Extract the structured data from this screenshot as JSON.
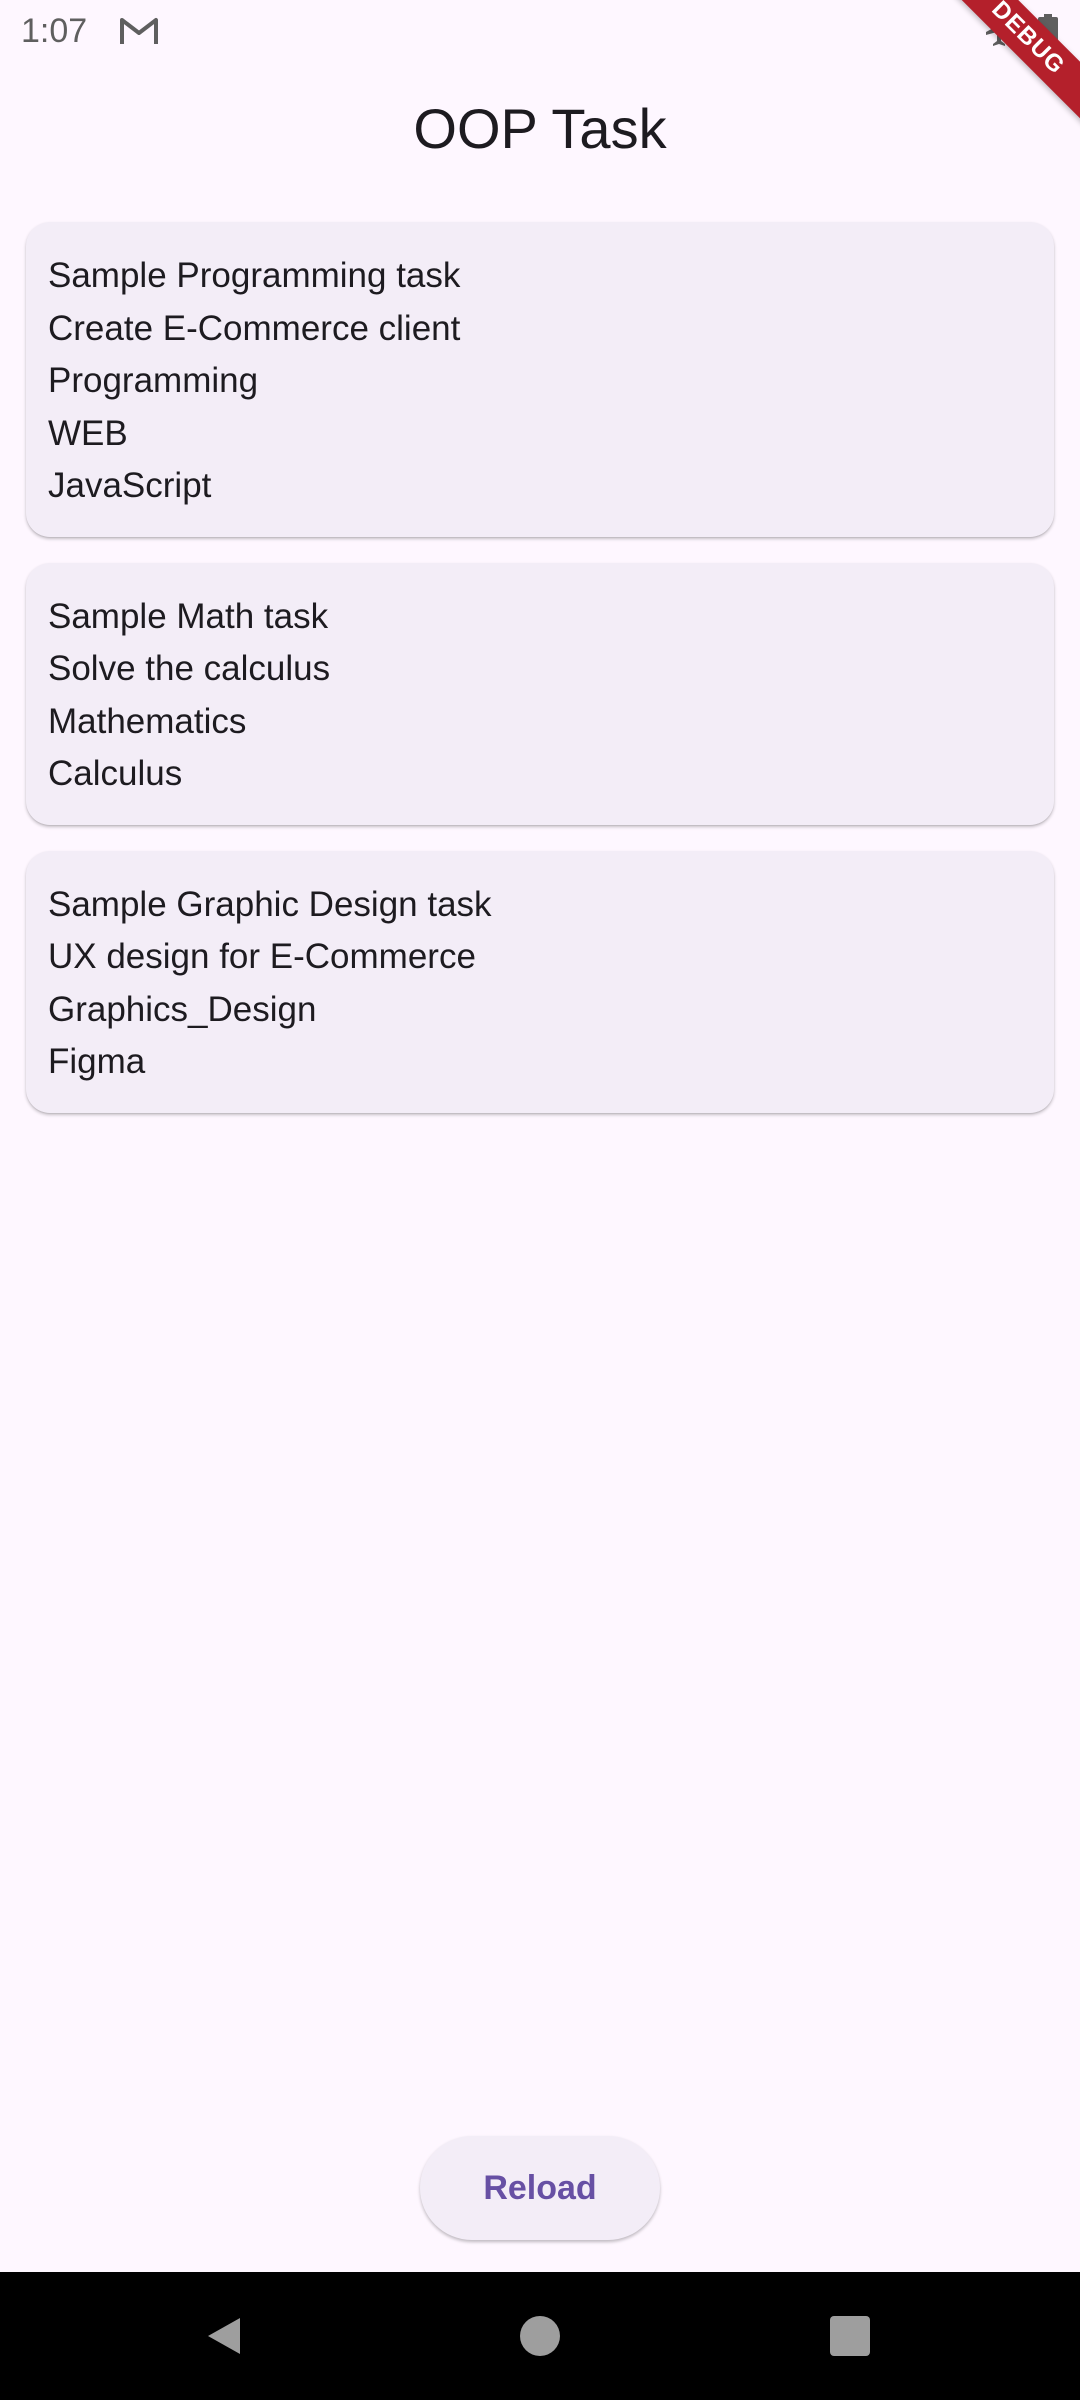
{
  "status_bar": {
    "time": "1:07",
    "icons": [
      "gmail-icon",
      "airplane-icon",
      "battery-icon"
    ]
  },
  "debug_banner": "DEBUG",
  "app_bar": {
    "title": "OOP Task"
  },
  "tasks": [
    {
      "title": "Sample Programming task",
      "description": "Create E-Commerce client",
      "category": "Programming",
      "subcategory": "WEB",
      "tool": "JavaScript"
    },
    {
      "title": "Sample Math task",
      "description": "Solve the calculus",
      "category": "Mathematics",
      "subcategory": "Calculus"
    },
    {
      "title": "Sample Graphic Design task",
      "description": "UX design for E-Commerce",
      "category": "Graphics_Design",
      "subcategory": "Figma"
    }
  ],
  "reload_button": {
    "label": "Reload"
  },
  "colors": {
    "background": "#FEF7FF",
    "card": "#F3EDF7",
    "primary": "#6750A4",
    "text": "#1D1B20",
    "debug_banner": "#B4202B"
  },
  "nav_bar": {
    "icons": [
      "back-icon",
      "home-icon",
      "recents-icon"
    ]
  }
}
